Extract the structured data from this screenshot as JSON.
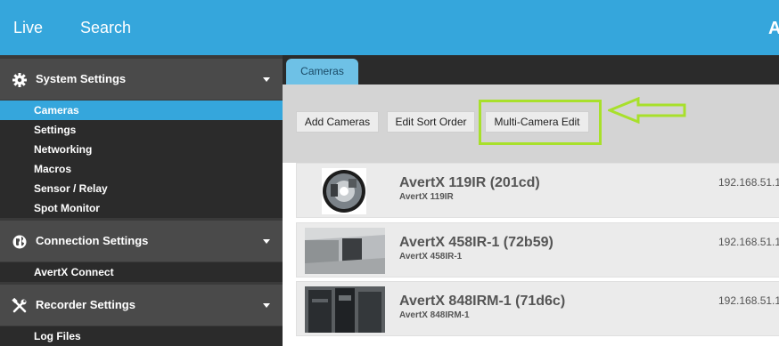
{
  "topbar": {
    "nav_live": "Live",
    "nav_search": "Search",
    "logo_text": "A"
  },
  "sidebar": {
    "sections": [
      {
        "label": "System Settings",
        "icon": "gear-icon",
        "items": [
          "Cameras",
          "Settings",
          "Networking",
          "Macros",
          "Sensor / Relay",
          "Spot Monitor"
        ],
        "active_item": "Cameras"
      },
      {
        "label": "Connection Settings",
        "icon": "globe-icon",
        "items": [
          "AvertX Connect"
        ]
      },
      {
        "label": "Recorder Settings",
        "icon": "tools-icon",
        "items": [
          "Log Files"
        ]
      }
    ]
  },
  "main": {
    "tab_label": "Cameras",
    "toolbar": {
      "add_label": "Add Cameras",
      "sort_label": "Edit Sort Order",
      "multi_label": "Multi-Camera Edit"
    },
    "cameras": [
      {
        "name": "AvertX 119IR (201cd)",
        "model": "AvertX 119IR",
        "ip": "192.168.51.1"
      },
      {
        "name": "AvertX 458IR-1 (72b59)",
        "model": "AvertX 458IR-1",
        "ip": "192.168.51.1"
      },
      {
        "name": "AvertX 848IRM-1 (71d6c)",
        "model": "AvertX 848IRM-1",
        "ip": "192.168.51.1"
      }
    ]
  },
  "colors": {
    "accent": "#35a6dc",
    "sidebar_bg": "#3a3a3a",
    "highlight": "#a8e02b"
  }
}
